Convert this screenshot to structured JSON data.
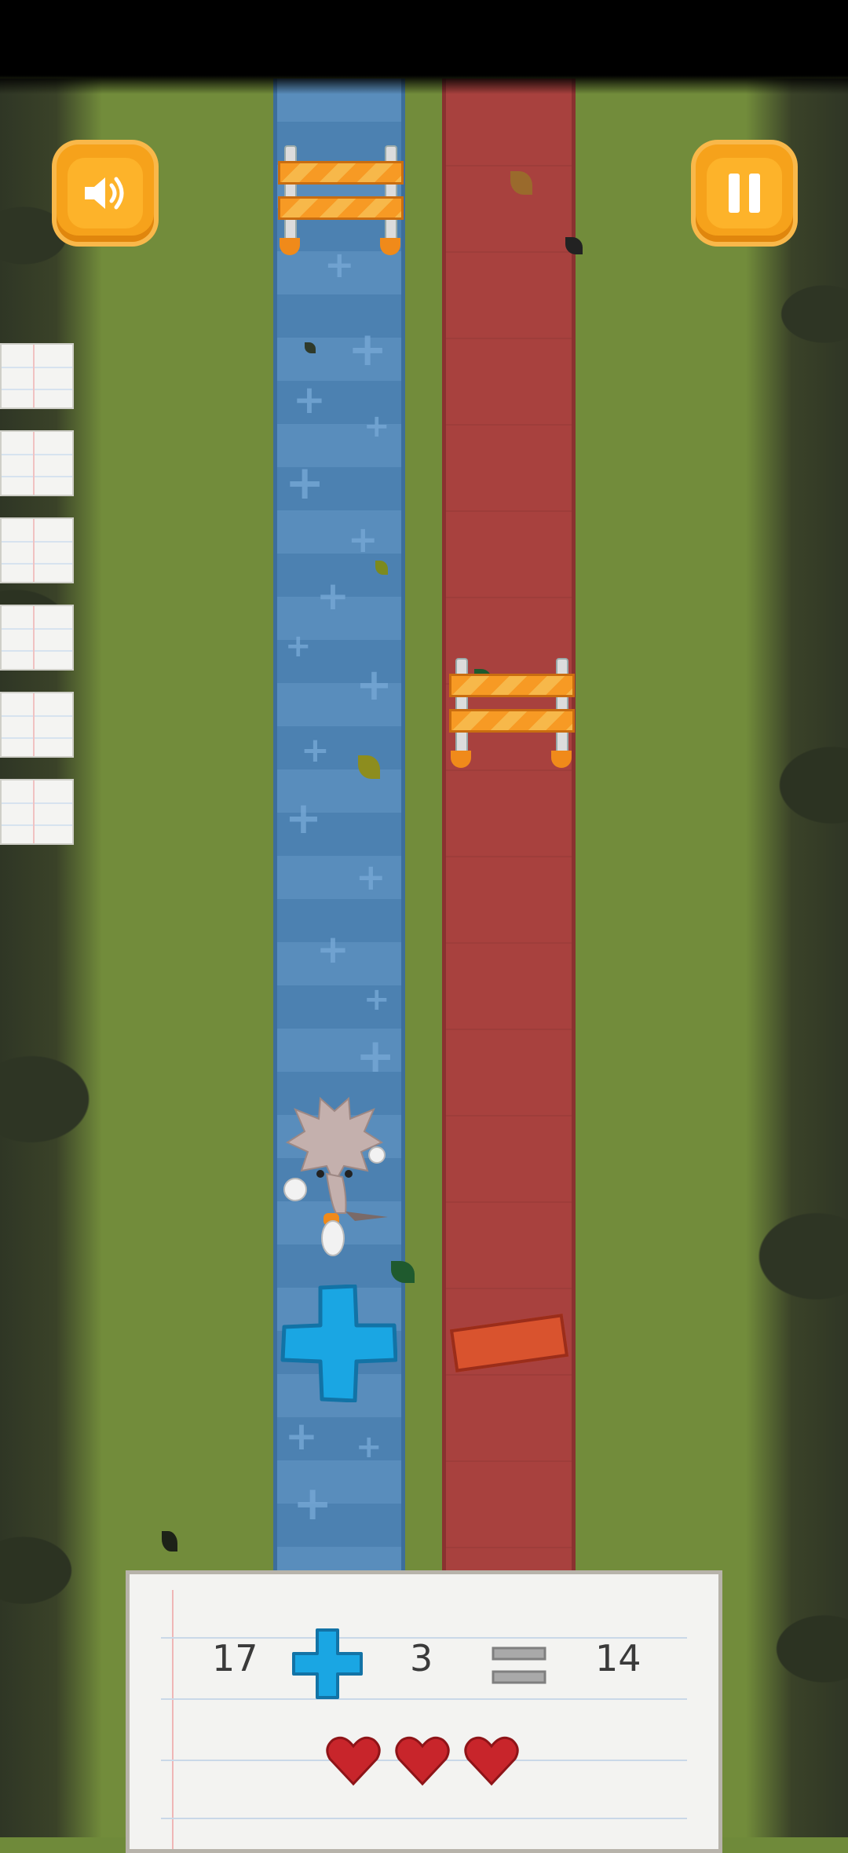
{
  "hud": {
    "sound_icon": "speaker-icon",
    "pause_icon": "pause-icon"
  },
  "equation": {
    "left": "17",
    "operator": "plus",
    "right": "3",
    "equals": "equals",
    "result": "14"
  },
  "lives": {
    "count": 3,
    "icon": "heart-icon"
  },
  "colors": {
    "blue_lane": "#4f86b8",
    "red_lane": "#a8413e",
    "grass": "#728c3b",
    "button_orange": "#f6a21b",
    "plus_powerup": "#1aa6e3",
    "heart": "#c8252b"
  },
  "side_cards": 6
}
